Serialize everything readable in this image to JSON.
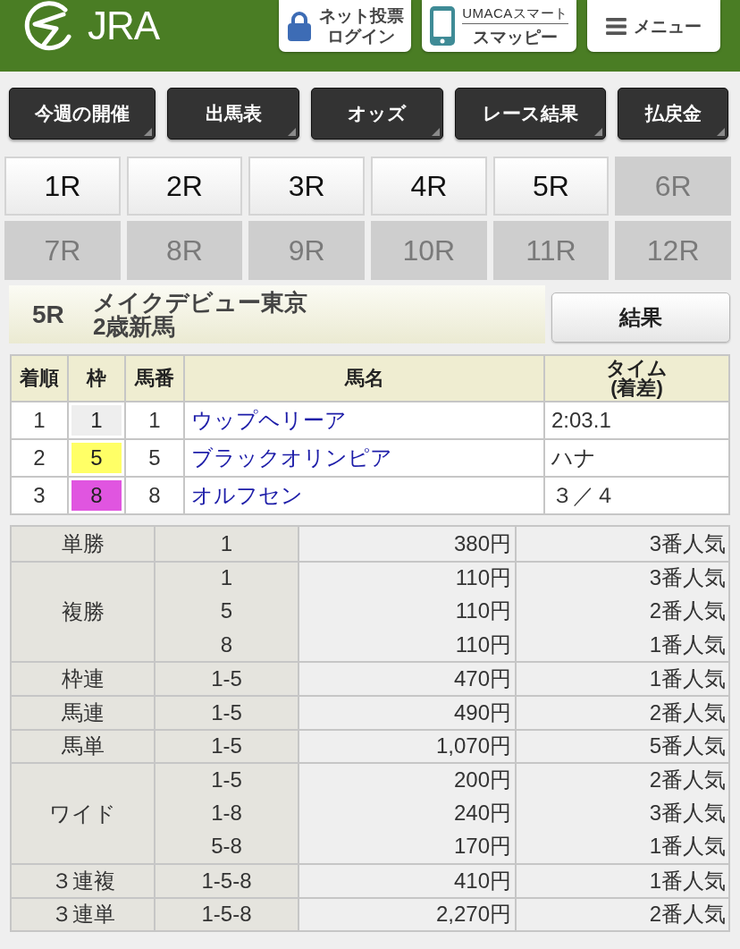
{
  "header": {
    "logo": "JRA",
    "buttons": [
      {
        "kind": "lock",
        "lines": [
          "ネット投票",
          "ログイン"
        ]
      },
      {
        "kind": "phone",
        "lines": [
          "UMACAスマート",
          "スマッピー"
        ]
      },
      {
        "kind": "menu",
        "lines": [
          "メニュー"
        ]
      }
    ]
  },
  "nav_buttons": [
    {
      "label": "今週の開催"
    },
    {
      "label": "出馬表"
    },
    {
      "label": "オッズ"
    },
    {
      "label": "レース結果"
    },
    {
      "label": "払戻金"
    }
  ],
  "race_buttons": [
    {
      "label": "1R",
      "disabled": false
    },
    {
      "label": "2R",
      "disabled": false
    },
    {
      "label": "3R",
      "disabled": false
    },
    {
      "label": "4R",
      "disabled": false
    },
    {
      "label": "5R",
      "disabled": false
    },
    {
      "label": "6R",
      "disabled": true
    },
    {
      "label": "7R",
      "disabled": true
    },
    {
      "label": "8R",
      "disabled": true
    },
    {
      "label": "9R",
      "disabled": true
    },
    {
      "label": "10R",
      "disabled": true
    },
    {
      "label": "11R",
      "disabled": true
    },
    {
      "label": "12R",
      "disabled": true
    }
  ],
  "race_header": {
    "number": "5R",
    "name": "メイクデビュー東京",
    "category": "2歳新馬",
    "button": "結果"
  },
  "results": {
    "columns": [
      {
        "label": "着順"
      },
      {
        "label": "枠"
      },
      {
        "label": "馬番"
      },
      {
        "label": "馬名"
      },
      {
        "label": "タイム",
        "sublabel": "(着差)"
      }
    ],
    "rows": [
      {
        "place": "1",
        "frame": "1",
        "color": "#eeeeee",
        "number": "1",
        "horse": "ウップヘリーア",
        "time": "2:03.1"
      },
      {
        "place": "2",
        "frame": "5",
        "color": "#ffff66",
        "number": "5",
        "horse": "ブラックオリンピア",
        "time": "ハナ"
      },
      {
        "place": "3",
        "frame": "8",
        "color": "#e055e0",
        "number": "8",
        "horse": "オルフセン",
        "time": "３／４"
      }
    ]
  },
  "payouts": [
    {
      "type": "単勝",
      "entries": [
        {
          "combination": "1",
          "amount": "380円",
          "popularity": "3番人気"
        }
      ]
    },
    {
      "type": "複勝",
      "entries": [
        {
          "combination": "1",
          "amount": "110円",
          "popularity": "3番人気"
        },
        {
          "combination": "5",
          "amount": "110円",
          "popularity": "2番人気"
        },
        {
          "combination": "8",
          "amount": "110円",
          "popularity": "1番人気"
        }
      ]
    },
    {
      "type": "枠連",
      "entries": [
        {
          "combination": "1-5",
          "amount": "470円",
          "popularity": "1番人気"
        }
      ]
    },
    {
      "type": "馬連",
      "entries": [
        {
          "combination": "1-5",
          "amount": "490円",
          "popularity": "2番人気"
        }
      ]
    },
    {
      "type": "馬単",
      "entries": [
        {
          "combination": "1-5",
          "amount": "1,070円",
          "popularity": "5番人気"
        }
      ]
    },
    {
      "type": "ワイド",
      "entries": [
        {
          "combination": "1-5",
          "amount": "200円",
          "popularity": "2番人気"
        },
        {
          "combination": "1-8",
          "amount": "240円",
          "popularity": "3番人気"
        },
        {
          "combination": "5-8",
          "amount": "170円",
          "popularity": "1番人気"
        }
      ]
    },
    {
      "type": "３連複",
      "entries": [
        {
          "combination": "1-5-8",
          "amount": "410円",
          "popularity": "1番人気"
        }
      ]
    },
    {
      "type": "３連単",
      "entries": [
        {
          "combination": "1-5-8",
          "amount": "2,270円",
          "popularity": "2番人気"
        }
      ]
    }
  ]
}
